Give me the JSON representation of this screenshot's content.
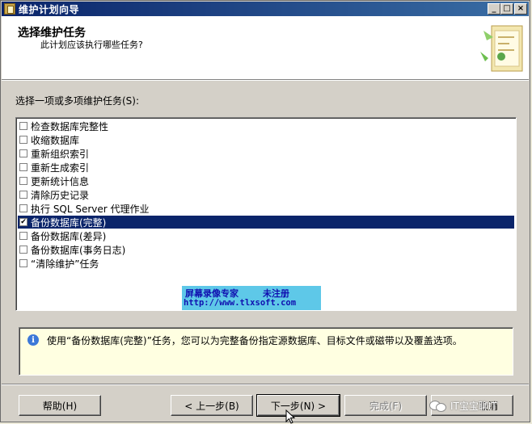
{
  "window": {
    "title": "维护计划向导",
    "controls": {
      "minimize": "_",
      "maximize": "□",
      "close": "×"
    }
  },
  "header": {
    "title": "选择维护任务",
    "subtitle": "此计划应该执行哪些任务?"
  },
  "tasks": {
    "label": "选择一项或多项维护任务(S):",
    "items": [
      {
        "label": "检查数据库完整性",
        "checked": false,
        "selected": false
      },
      {
        "label": "收缩数据库",
        "checked": false,
        "selected": false
      },
      {
        "label": "重新组织索引",
        "checked": false,
        "selected": false
      },
      {
        "label": "重新生成索引",
        "checked": false,
        "selected": false
      },
      {
        "label": "更新统计信息",
        "checked": false,
        "selected": false
      },
      {
        "label": "清除历史记录",
        "checked": false,
        "selected": false
      },
      {
        "label": "执行 SQL Server 代理作业",
        "checked": false,
        "selected": false
      },
      {
        "label": "备份数据库(完整)",
        "checked": true,
        "selected": true
      },
      {
        "label": "备份数据库(差异)",
        "checked": false,
        "selected": false
      },
      {
        "label": "备份数据库(事务日志)",
        "checked": false,
        "selected": false
      },
      {
        "label": "“清除维护”任务",
        "checked": false,
        "selected": false
      }
    ],
    "check_mark": "✔"
  },
  "watermark": {
    "line1a": "屏幕录像专家",
    "line1b": "未注册",
    "line2": "http://www.tlxsoft.com"
  },
  "description": {
    "icon": "info-icon",
    "text": "使用“备份数据库(完整)”任务，您可以为完整备份指定源数据库、目标文件或磁带以及覆盖选项。"
  },
  "buttons": {
    "help": "帮助(H)",
    "back": "< 上一步(B)",
    "next": "下一步(N) >",
    "finish": "完成(F)",
    "cancel": "取消"
  },
  "overlay": {
    "social_label": "IT宝宝聊IT"
  }
}
